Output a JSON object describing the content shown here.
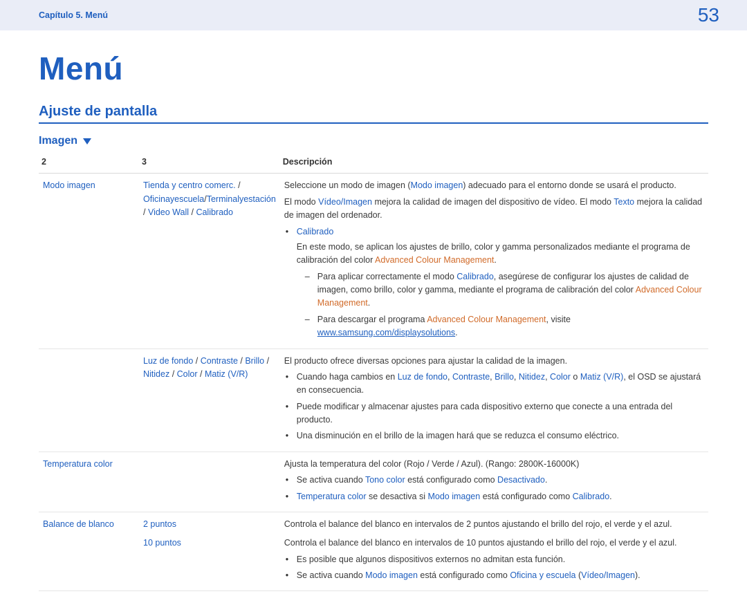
{
  "header": {
    "breadcrumb": "Capítulo 5. Menú",
    "page_number": "53"
  },
  "title": "Menú",
  "section": "Ajuste de pantalla",
  "subsection": "Imagen",
  "thead": {
    "c1": "2",
    "c2": "3",
    "c3": "Descripción"
  },
  "row1": {
    "c1": {
      "modo_imagen": "Modo imagen"
    },
    "c2": {
      "tienda": "Tienda y centro comerc.",
      "sep1": " / ",
      "oficina": "Oficinayescuela",
      "slash1": "/",
      "terminal": "Terminalyestación",
      "sep2": " / ",
      "videowall": "Video Wall",
      "sep3": " / ",
      "calibrado": "Calibrado"
    },
    "d": {
      "p1a": "Seleccione un modo de imagen (",
      "p1b": "Modo imagen",
      "p1c": ") adecuado para el entorno donde se usará el producto.",
      "p2a": "El modo ",
      "p2b": "Vídeo/Imagen",
      "p2c": " mejora la calidad de imagen del dispositivo de vídeo. El modo ",
      "p2d": "Texto",
      "p2e": " mejora la calidad de imagen del ordenador.",
      "li1": "Calibrado",
      "li1_sub1a": "En este modo, se aplican los ajustes de brillo, color y gamma personalizados mediante el programa de calibración del color ",
      "li1_sub1b": "Advanced Colour Management",
      "li1_sub1c": ".",
      "li1_sub2a": "Para aplicar correctamente el modo ",
      "li1_sub2b": "Calibrado",
      "li1_sub2c": ", asegúrese de configurar los ajustes de calidad de imagen, como brillo, color y gamma, mediante el programa de calibración del color ",
      "li1_sub2d": "Advanced Colour Management",
      "li1_sub2e": ".",
      "li1_sub3a": "Para descargar el programa ",
      "li1_sub3b": "Advanced Colour Management",
      "li1_sub3c": ", visite ",
      "li1_sub3d": "www.samsung.com/displaysolutions",
      "li1_sub3e": "."
    }
  },
  "row2": {
    "c2": {
      "luz": "Luz de fondo",
      "s1": " / ",
      "contraste": "Contraste",
      "s2": " / ",
      "brillo": "Brillo",
      "s3": " / ",
      "nitidez": "Nitidez",
      "s4": " / ",
      "color": "Color",
      "s5": " / ",
      "matiz": "Matiz (V/R)"
    },
    "d": {
      "p1": "El producto ofrece diversas opciones para ajustar la calidad de la imagen.",
      "b1a": "Cuando haga cambios en ",
      "b1_luz": "Luz de fondo",
      "b1_c1": ", ",
      "b1_con": "Contraste",
      "b1_c2": ", ",
      "b1_bri": "Brillo",
      "b1_c3": ", ",
      "b1_nit": "Nitidez",
      "b1_c4": ", ",
      "b1_col": "Color",
      "b1_c5": " o ",
      "b1_mat": "Matiz (V/R)",
      "b1b": ", el OSD se ajustará en consecuencia.",
      "b2": "Puede modificar y almacenar ajustes para cada dispositivo externo que conecte a una entrada del producto.",
      "b3": "Una disminución en el brillo de la imagen hará que se reduzca el consumo eléctrico."
    }
  },
  "row3": {
    "c1": "Temperatura color",
    "d": {
      "p1": "Ajusta la temperatura del color (Rojo / Verde / Azul). (Rango: 2800K-16000K)",
      "b1a": "Se activa cuando ",
      "b1b": "Tono color",
      "b1c": " está configurado como ",
      "b1d": "Desactivado",
      "b1e": ".",
      "b2a": "Temperatura color",
      "b2b": " se desactiva si ",
      "b2c": "Modo imagen",
      "b2d": " está configurado como ",
      "b2e": "Calibrado",
      "b2f": "."
    }
  },
  "row4": {
    "c1": "Balance de blanco",
    "c2a": "2 puntos",
    "c2b": "10 puntos",
    "d": {
      "p1": "Controla el balance del blanco en intervalos de 2 puntos ajustando el brillo del rojo, el verde y el azul.",
      "p2": "Controla el balance del blanco en intervalos de 10 puntos ajustando el brillo del rojo, el verde y el azul.",
      "b1": "Es posible que algunos dispositivos externos no admitan esta función.",
      "b2a": "Se activa cuando ",
      "b2b": "Modo imagen",
      "b2c": " está configurado como ",
      "b2d": "Oficina y escuela",
      "b2e": " (",
      "b2f": "Vídeo/Imagen",
      "b2g": ")."
    }
  }
}
